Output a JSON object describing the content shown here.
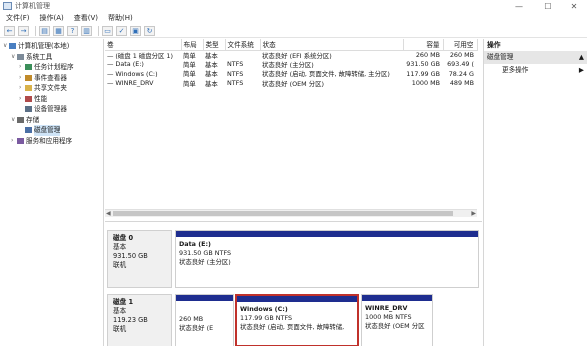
{
  "window": {
    "title": "计算机管理",
    "minimize": "—",
    "maximize": "☐",
    "close": "✕"
  },
  "menu": [
    "文件(F)",
    "操作(A)",
    "查看(V)",
    "帮助(H)"
  ],
  "tree": [
    {
      "label": "计算机管理(本地)",
      "indent": 0,
      "toggle": "∨",
      "icon": "computer-icon"
    },
    {
      "label": "系统工具",
      "indent": 1,
      "toggle": "∨",
      "icon": "tools-icon"
    },
    {
      "label": "任务计划程序",
      "indent": 2,
      "toggle": "›",
      "icon": "task-scheduler-icon"
    },
    {
      "label": "事件查看器",
      "indent": 2,
      "toggle": "›",
      "icon": "event-viewer-icon"
    },
    {
      "label": "共享文件夹",
      "indent": 2,
      "toggle": "›",
      "icon": "shared-folder-icon"
    },
    {
      "label": "性能",
      "indent": 2,
      "toggle": "›",
      "icon": "performance-icon"
    },
    {
      "label": "设备管理器",
      "indent": 2,
      "toggle": "",
      "icon": "device-manager-icon"
    },
    {
      "label": "存储",
      "indent": 1,
      "toggle": "∨",
      "icon": "storage-icon"
    },
    {
      "label": "磁盘管理",
      "indent": 2,
      "toggle": "",
      "icon": "disk-management-icon",
      "selected": true
    },
    {
      "label": "服务和应用程序",
      "indent": 1,
      "toggle": "›",
      "icon": "services-icon"
    }
  ],
  "volumes": {
    "headers": [
      "卷",
      "布局",
      "类型",
      "文件系统",
      "状态",
      "容量",
      "可用空"
    ],
    "rows": [
      [
        "— (磁盘 1 磁盘分区 1)",
        "简单",
        "基本",
        "",
        "状态良好 (EFI 系统分区)",
        "260 MB",
        "260 MB"
      ],
      [
        "— Data (E:)",
        "简单",
        "基本",
        "NTFS",
        "状态良好 (主分区)",
        "931.50 GB",
        "693.49 ("
      ],
      [
        "— Windows (C:)",
        "简单",
        "基本",
        "NTFS",
        "状态良好 (启动, 页面文件, 故障转储, 主分区)",
        "117.99 GB",
        "78.24 G"
      ],
      [
        "— WINRE_DRV",
        "简单",
        "基本",
        "NTFS",
        "状态良好 (OEM 分区)",
        "1000 MB",
        "489 MB"
      ]
    ]
  },
  "disks": [
    {
      "name": "磁盘 0",
      "type": "基本",
      "size": "931.50 GB",
      "status": "联机",
      "partitions": [
        {
          "name": "Data (E:)",
          "line1": "931.50 GB NTFS",
          "line2": "状态良好 (主分区)"
        }
      ]
    },
    {
      "name": "磁盘 1",
      "type": "基本",
      "size": "119.23 GB",
      "status": "联机",
      "partitions": [
        {
          "name": "",
          "line1": "260 MB",
          "line2": "状态良好 (E"
        },
        {
          "name": "Windows (C:)",
          "line1": "117.99 GB NTFS",
          "line2": "状态良好 (启动, 页面文件, 故障转储,"
        },
        {
          "name": "WINRE_DRV",
          "line1": "1000 MB NTFS",
          "line2": "状态良好 (OEM 分区"
        }
      ]
    }
  ],
  "actions": {
    "header": "操作",
    "section": "磁盘管理",
    "section_arrow": "▲",
    "more": "更多操作",
    "more_arrow": "▶"
  },
  "colors": {
    "partition_bar": "#1e2d8f",
    "selection_border": "#c0312b"
  }
}
